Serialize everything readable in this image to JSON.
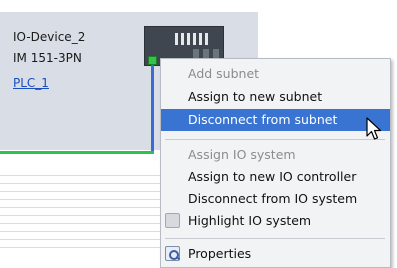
{
  "device": {
    "name": "IO-Device_2",
    "type": "IM 151-3PN",
    "controller_link": "PLC_1"
  },
  "menu": {
    "items": [
      {
        "label": "Add subnet",
        "state": "disabled"
      },
      {
        "label": "Assign to new subnet",
        "state": "enabled"
      },
      {
        "label": "Disconnect from subnet",
        "state": "selected"
      },
      {
        "label": "Assign IO system",
        "state": "disabled"
      },
      {
        "label": "Assign to new IO controller",
        "state": "enabled"
      },
      {
        "label": "Disconnect from IO system",
        "state": "enabled"
      },
      {
        "label": "Highlight IO system",
        "state": "enabled",
        "icon": "highlight-icon"
      },
      {
        "label": "Properties",
        "state": "enabled",
        "icon": "properties-icon"
      }
    ]
  },
  "colors": {
    "device_background": "#d9dde6",
    "selection": "#3a74d3",
    "profinet_line": "#3e6ad6",
    "subnet_line": "#2fc150",
    "port": "#36c24a"
  }
}
